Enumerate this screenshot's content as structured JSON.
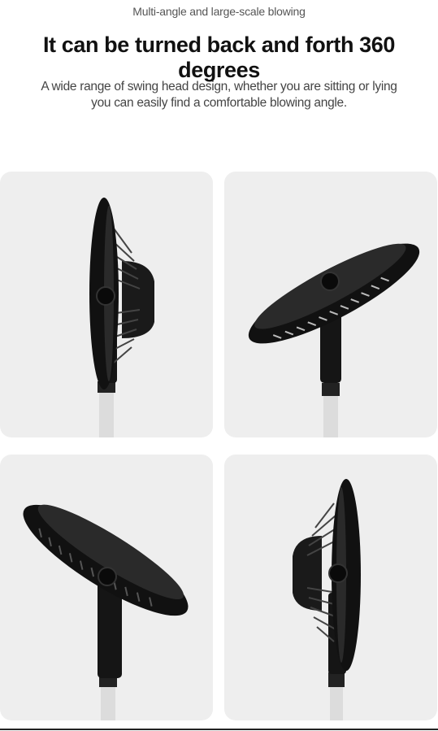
{
  "header": {
    "subtitle": "Multi-angle and large-scale blowing",
    "headline": "It can be turned back and forth 360 degrees",
    "description": "A wide range of swing head design, whether you are sitting or lying you can easily find a comfortable blowing angle."
  },
  "panels": [
    {
      "angle": "side-facing-right"
    },
    {
      "angle": "tilted-up"
    },
    {
      "angle": "tilted-down"
    },
    {
      "angle": "side-facing-left"
    }
  ],
  "colors": {
    "panel_background": "#eeeeee",
    "fan_body": "#111111",
    "pole": "#dcdcdc"
  }
}
